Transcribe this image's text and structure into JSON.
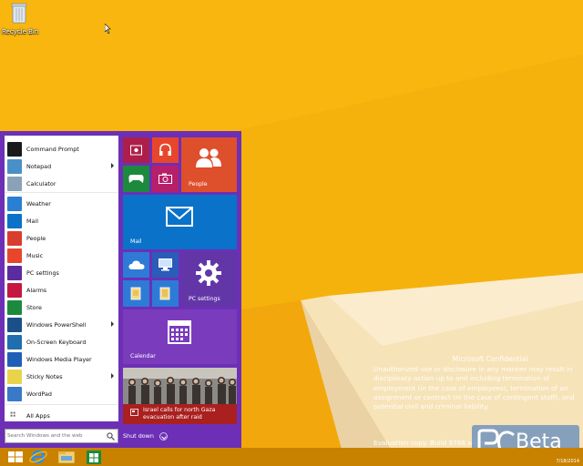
{
  "desktop": {
    "recycle_bin_label": "Recycle Bin",
    "watermark_title": "Microsoft Confidential",
    "watermark_body": "Unauthorized use or disclosure in any manner may result in disciplinary action up to and including termination of employment (in the case of employees), termination of an assignment or contract (in the case of contingent staff), and potential civil and criminal liability.",
    "evaluation_text": "Evaluation copy. Build 9788.winmain",
    "logo_text": "Beta",
    "colors": {
      "wallpaper": "#f6b20c",
      "wallpaper_light": "#fbc628",
      "start_purple": "#6c2fb6"
    }
  },
  "start_menu": {
    "apps": [
      {
        "label": "Command Prompt",
        "icon": "command-prompt-icon",
        "color": "#1a1a1a",
        "submenu": false
      },
      {
        "label": "Notepad",
        "icon": "notepad-icon",
        "color": "#4a90c8",
        "submenu": true
      },
      {
        "label": "Calculator",
        "icon": "calculator-icon",
        "color": "#8aa1b8",
        "submenu": false
      },
      {
        "label": "Weather",
        "icon": "weather-icon",
        "color": "#2a7fd4",
        "submenu": false
      },
      {
        "label": "Mail",
        "icon": "mail-icon",
        "color": "#0a72c8",
        "submenu": false
      },
      {
        "label": "People",
        "icon": "people-icon",
        "color": "#d93d2e",
        "submenu": false
      },
      {
        "label": "Music",
        "icon": "music-icon",
        "color": "#e8462c",
        "submenu": false
      },
      {
        "label": "PC settings",
        "icon": "gear-icon",
        "color": "#5a2c9e",
        "submenu": false
      },
      {
        "label": "Alarms",
        "icon": "alarm-icon",
        "color": "#c41840",
        "submenu": false
      },
      {
        "label": "Store",
        "icon": "store-icon",
        "color": "#1c8a3c",
        "submenu": false
      },
      {
        "label": "Windows PowerShell",
        "icon": "powershell-icon",
        "color": "#1b4f8a",
        "submenu": true
      },
      {
        "label": "On-Screen Keyboard",
        "icon": "keyboard-icon",
        "color": "#1f6fb0",
        "submenu": false
      },
      {
        "label": "Windows Media Player",
        "icon": "media-player-icon",
        "color": "#1f5fb8",
        "submenu": false
      },
      {
        "label": "Sticky Notes",
        "icon": "sticky-notes-icon",
        "color": "#e8d44c",
        "submenu": true
      },
      {
        "label": "WordPad",
        "icon": "wordpad-icon",
        "color": "#3a78c8",
        "submenu": false
      }
    ],
    "all_apps_label": "All Apps",
    "search_placeholder": "Search Windows and the web",
    "shutdown_label": "Shut down",
    "tiles": {
      "people": "People",
      "mail": "Mail",
      "pc_settings": "PC settings",
      "calendar": "Calendar",
      "news_headline_1": "Israel calls for north Gaza",
      "news_headline_2": "evacuation after raid"
    }
  },
  "taskbar": {
    "clock_date": "7/18/2014"
  }
}
